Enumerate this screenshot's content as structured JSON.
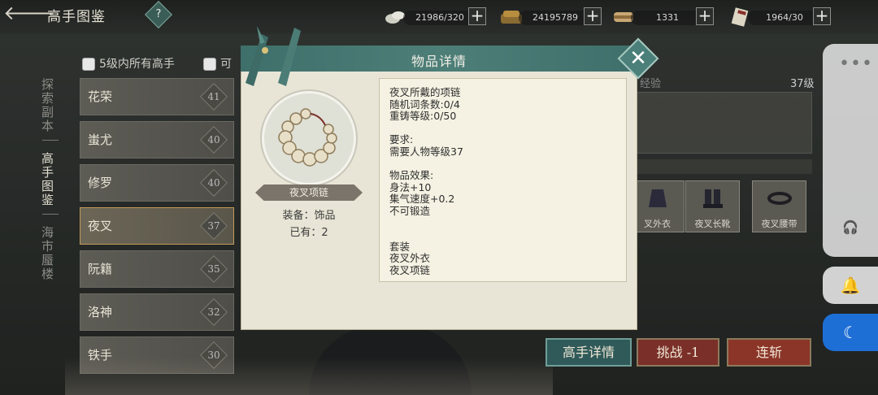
{
  "header": {
    "back_glyph": "🡐",
    "title": "高手图鉴",
    "help_glyph": "?"
  },
  "resources": [
    {
      "name": "silver-coin-icon",
      "value": "21986/320"
    },
    {
      "name": "gold-ingot-icon",
      "value": "24195789"
    },
    {
      "name": "scroll-icon",
      "value": "1331"
    },
    {
      "name": "ticket-icon",
      "value": "1964/30"
    }
  ],
  "vertical_menu": [
    {
      "label": "探索副本",
      "active": false
    },
    {
      "label": "高手图鉴",
      "active": true
    },
    {
      "label": "海市蜃楼",
      "active": false
    }
  ],
  "filters": {
    "first": "5级内所有高手",
    "second": "可"
  },
  "heroes": [
    {
      "name": "花荣",
      "level": "41"
    },
    {
      "name": "蚩尤",
      "level": "40"
    },
    {
      "name": "修罗",
      "level": "40"
    },
    {
      "name": "夜叉",
      "level": "37",
      "active": true
    },
    {
      "name": "阮籍",
      "level": "35"
    },
    {
      "name": "洛神",
      "level": "32"
    },
    {
      "name": "铁手",
      "level": "30"
    }
  ],
  "right_panel": {
    "exp_label": "经验",
    "level_label": "37级",
    "equipment": [
      {
        "label": "叉外衣"
      },
      {
        "label": "夜叉长靴"
      },
      {
        "label": "夜叉腰带"
      }
    ]
  },
  "actions": {
    "detail": "高手详情",
    "challenge": "挑战 -1",
    "sweep": "连斩"
  },
  "dialog": {
    "title": "物品详情",
    "close_glyph": "✕",
    "item": {
      "name": "夜叉项链",
      "slot": "装备：饰品",
      "owned": "已有：2"
    },
    "description": {
      "line1": "夜叉所戴的项链",
      "line2": "随机词条数:0/4",
      "line3": "重铸等级:0/50",
      "req_title": "要求:",
      "req_line": "需要人物等级37",
      "effect_title": "物品效果:",
      "effect1": "身法+10",
      "effect2": "集气速度+0.2",
      "effect3": "不可锻造",
      "set_title": "套装",
      "set1": "夜叉外衣",
      "set2": "夜叉项链"
    }
  },
  "system_buttons": {
    "dots": "•••",
    "headset": "🎧",
    "bell": "🔔",
    "moon": "☾"
  }
}
